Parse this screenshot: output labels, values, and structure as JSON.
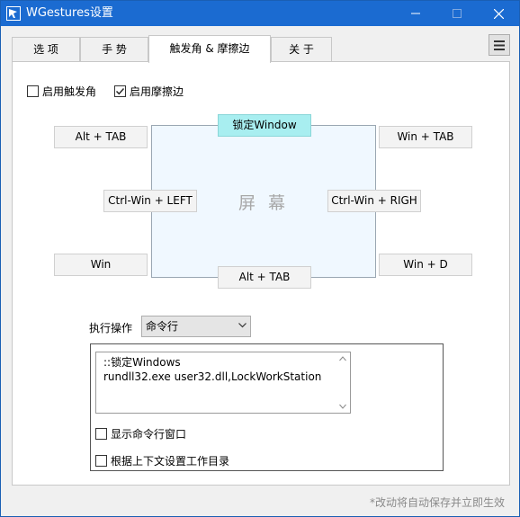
{
  "window": {
    "title": "WGestures设置"
  },
  "tabs": [
    {
      "label": "选 项"
    },
    {
      "label": "手 势"
    },
    {
      "label": "触发角 & 摩擦边"
    },
    {
      "label": "关 于"
    }
  ],
  "toggles": {
    "hot_corner": {
      "label": "启用触发角",
      "checked": false
    },
    "rubbing_edge": {
      "label": "启用摩擦边",
      "checked": true
    }
  },
  "screen": {
    "label": "屏 幕",
    "corners": {
      "top_left": "Alt + TAB",
      "top_right": "Win + TAB",
      "bottom_left": "Win",
      "bottom_right": "Win + D"
    },
    "edges": {
      "top": "锁定Window",
      "left": "Ctrl-Win + LEFT",
      "right": "Ctrl-Win  + RIGH",
      "bottom": "Alt + TAB"
    }
  },
  "action": {
    "label": "执行操作",
    "selected": "命令行",
    "command_lines": [
      "::锁定Windows",
      "rundll32.exe user32.dll,LockWorkStation"
    ],
    "show_window": {
      "label": "显示命令行窗口",
      "checked": false
    },
    "use_context_dir": {
      "label": "根据上下文设置工作目录",
      "checked": false
    }
  },
  "footer": {
    "note": "*改动将自动保存并立即生效"
  },
  "colors": {
    "titlebar": "#1b6bd1",
    "active_edge": "#a8eef0",
    "screen_fill": "#f0f8ff"
  }
}
